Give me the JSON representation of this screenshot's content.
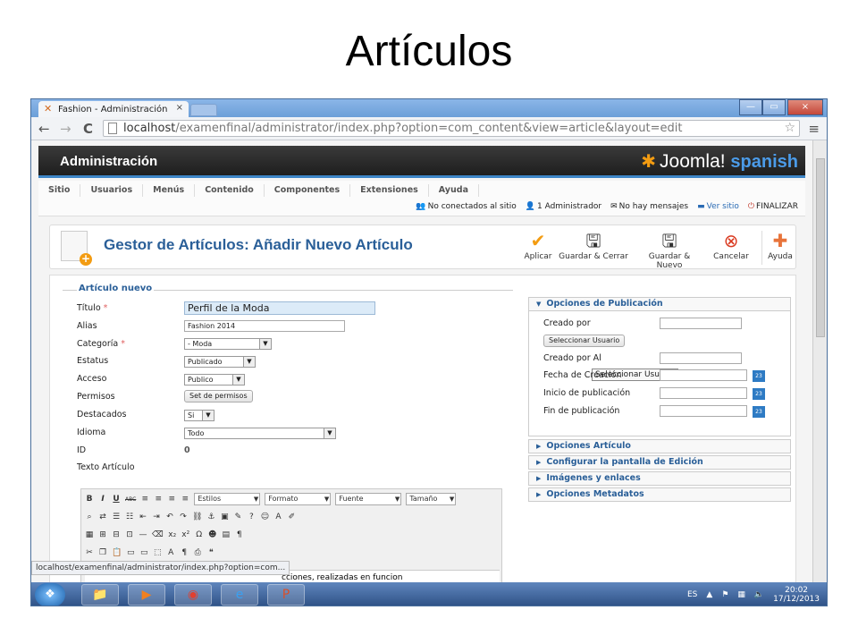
{
  "slide": {
    "title": "Artículos"
  },
  "browser": {
    "tab_title": "Fashion - Administración",
    "tab_close": "×",
    "url_host": "localhost",
    "url_path": "/examenfinal/administrator/index.php?option=com_content&view=article&layout=edit",
    "status_url": "localhost/examenfinal/administrator/index.php?option=com...",
    "win_min": "—",
    "win_max": "▭",
    "win_close": "×",
    "back": "←",
    "forward": "→",
    "reload": "C",
    "star": "☆",
    "menu": "≡"
  },
  "admin": {
    "title": "Administración",
    "brand": "Joomla!",
    "brand_suffix": "spanish",
    "menus": [
      "Sitio",
      "Usuarios",
      "Menús",
      "Contenido",
      "Componentes",
      "Extensiones",
      "Ayuda"
    ],
    "status": {
      "connected": "No conectados al sitio",
      "admins": "1 Administrador",
      "messages": "No hay mensajes",
      "view_site": "Ver sitio",
      "logout": "FINALIZAR"
    }
  },
  "toolbar": {
    "title": "Gestor de Artículos: Añadir Nuevo Artículo",
    "apply": "Aplicar",
    "save_close": "Guardar & Cerrar",
    "save_new": "Guardar & Nuevo",
    "cancel": "Cancelar",
    "help": "Ayuda"
  },
  "form": {
    "legend": "Artículo nuevo",
    "title_label": "Título",
    "title_value": "Perfil de la Moda",
    "alias_label": "Alias",
    "alias_value": "Fashion 2014",
    "category_label": "Categoría",
    "category_value": "- Moda",
    "state_label": "Estatus",
    "state_value": "Publicado",
    "access_label": "Acceso",
    "access_value": "Publico",
    "permissions_label": "Permisos",
    "permissions_button": "Set de permisos",
    "featured_label": "Destacados",
    "featured_value": "Si",
    "language_label": "Idioma",
    "language_value": "Todo",
    "id_label": "ID",
    "id_value": "0",
    "text_label": "Texto Artículo",
    "req": "*"
  },
  "editor": {
    "styles": "Estilos",
    "format": "Formato",
    "font": "Fuente",
    "size": "Tamaño",
    "content_fragment": "cciones, realizadas en funcion"
  },
  "publishing": {
    "header": "Opciones de Publicación",
    "created_by": "Creado por",
    "select_user": "Seleccionar Usuario",
    "created_by_alias": "Creado por Al",
    "tooltip": "Seleccionar Usuario",
    "created_date": "Fecha de Creación",
    "publish_up": "Inicio de publicación",
    "publish_down": "Fin de publicación",
    "cal": "23"
  },
  "panels": [
    "Opciones Artículo",
    "Configurar la pantalla de Edición",
    "Imágenes y enlaces",
    "Opciones Metadatos"
  ],
  "taskbar": {
    "lang": "ES",
    "time": "20:02",
    "date": "17/12/2013"
  }
}
